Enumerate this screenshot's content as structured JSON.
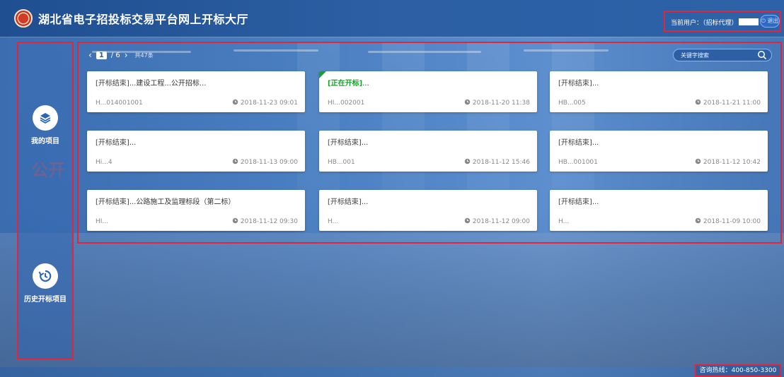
{
  "header": {
    "title": "湖北省电子招投标交易平台网上开标大厅",
    "user_label": "当前用户：（招标代理）",
    "logout_label": "退出"
  },
  "sidebar": {
    "items": [
      {
        "label": "我的项目",
        "icon": "layers-icon"
      },
      {
        "label": "历史开标项目",
        "icon": "history-icon"
      }
    ],
    "watermark": "公开"
  },
  "pager": {
    "current": "1",
    "total": "/ 6",
    "count": "共47条"
  },
  "search": {
    "placeholder": "关键字搜索"
  },
  "cards": [
    {
      "status": "[开标结束]",
      "title": "...建设工程...公开招标...",
      "code": "H...014001001",
      "time": "2018-11-23 09:01",
      "live": false
    },
    {
      "status": "[正在开标]",
      "title": "...",
      "code": "HI...002001",
      "time": "2018-11-20 11:38",
      "live": true
    },
    {
      "status": "[开标结束]",
      "title": "...",
      "code": "HB...005",
      "time": "2018-11-21 11:00",
      "live": false
    },
    {
      "status": "[开标结束]",
      "title": "...",
      "code": "Hi...4",
      "time": "2018-11-13 09:00",
      "live": false
    },
    {
      "status": "[开标结束]",
      "title": "...",
      "code": "HB...001",
      "time": "2018-11-12 15:46",
      "live": false
    },
    {
      "status": "[开标结束]",
      "title": "...",
      "code": "HB...001001",
      "time": "2018-11-12 10:42",
      "live": false
    },
    {
      "status": "[开标结束]",
      "title": "...公路施工及监理标段（第二标）",
      "code": "HI...",
      "time": "2018-11-12 09:30",
      "live": false
    },
    {
      "status": "[开标结束]",
      "title": "...",
      "code": "H...",
      "time": "2018-11-12 09:00",
      "live": false
    },
    {
      "status": "[开标结束]",
      "title": "...",
      "code": "H...",
      "time": "2018-11-09 10:00",
      "live": false
    }
  ],
  "footer": {
    "hotline": "咨询热线：400-850-3300"
  },
  "colors": {
    "header_bg": "#2c5fa4",
    "accent_red": "#e0263a",
    "live_green": "#18a02d"
  }
}
